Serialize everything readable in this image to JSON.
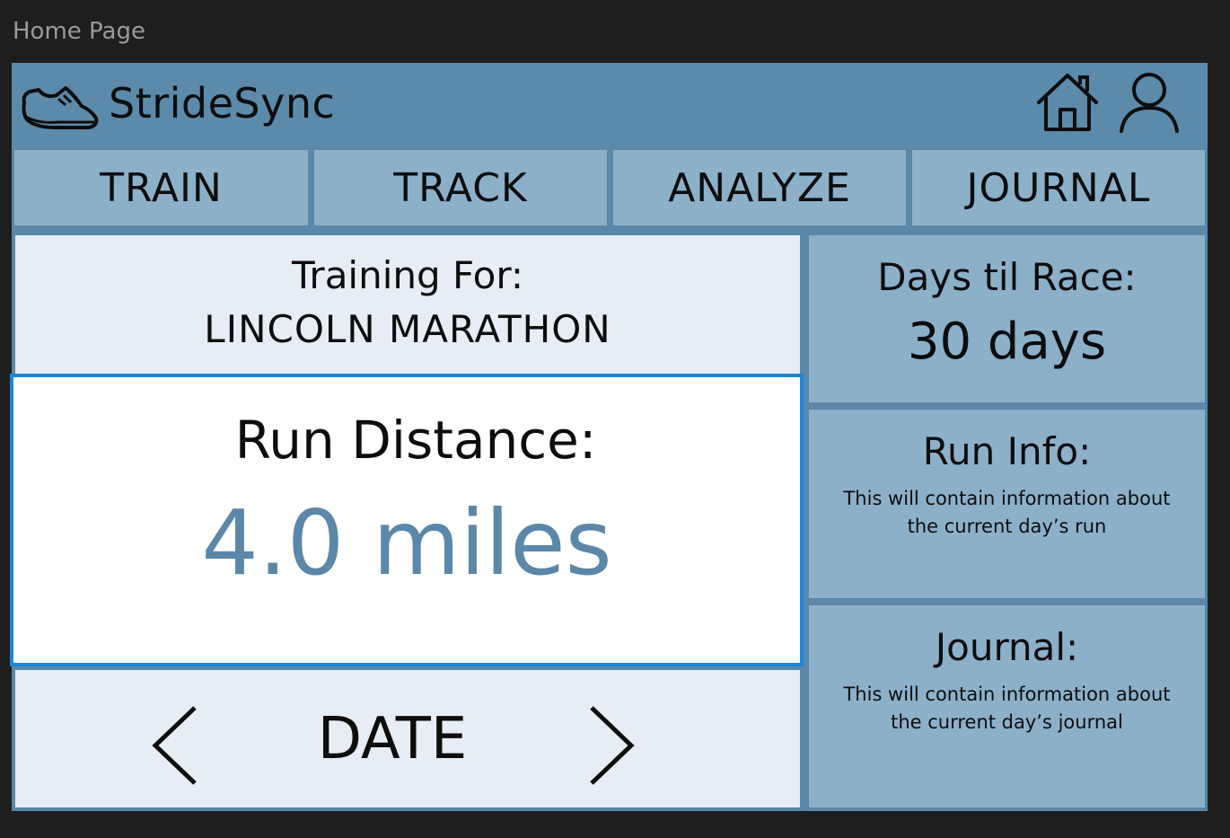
{
  "window": {
    "title": "Home Page"
  },
  "header": {
    "brand": "StrideSync",
    "logo_icon": "sneaker-icon",
    "home_icon": "home-icon",
    "user_icon": "user-icon"
  },
  "nav": {
    "tabs": [
      {
        "label": "TRAIN"
      },
      {
        "label": "TRACK"
      },
      {
        "label": "ANALYZE"
      },
      {
        "label": "JOURNAL"
      }
    ]
  },
  "training": {
    "label": "Training For:",
    "race": "LINCOLN MARATHON"
  },
  "run_distance": {
    "label": "Run Distance:",
    "value": "4.0 miles"
  },
  "date_nav": {
    "label": "DATE",
    "prev_icon": "chevron-left-icon",
    "next_icon": "chevron-right-icon"
  },
  "days_til_race": {
    "title": "Days til Race:",
    "value": "30 days"
  },
  "run_info": {
    "title": "Run Info:",
    "description": "This will contain information about the current day’s run"
  },
  "journal": {
    "title": "Journal:",
    "description": "This will contain information about the current day’s journal"
  },
  "colors": {
    "header_bg": "#5b8aab",
    "tab_bg": "#8db0c9",
    "panel_light": "#e6edf5",
    "accent_border": "#1a86d9",
    "distance_text": "#5b87a8",
    "background": "#1e1e1e"
  }
}
